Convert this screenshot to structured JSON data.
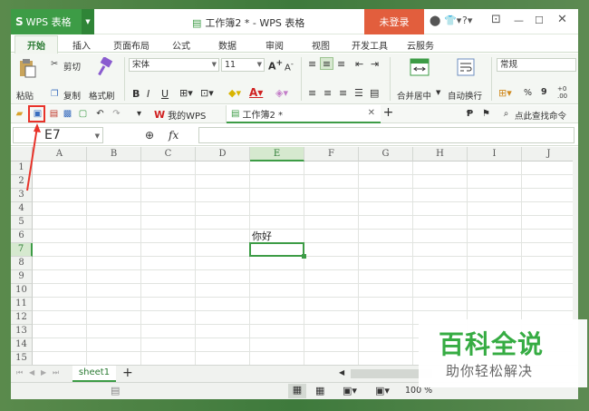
{
  "app": {
    "name": "WPS 表格",
    "logo": "S"
  },
  "document": {
    "title": "工作簿2 * - WPS 表格"
  },
  "titlebar": {
    "login": "未登录"
  },
  "menu": {
    "tabs": [
      "开始",
      "插入",
      "页面布局",
      "公式",
      "数据",
      "审阅",
      "视图",
      "开发工具",
      "云服务"
    ]
  },
  "ribbon": {
    "paste": "粘贴",
    "cut": "剪切",
    "copy": "复制",
    "format_painter": "格式刷",
    "font_name": "宋体",
    "font_size": "11",
    "bold": "B",
    "italic": "I",
    "underline": "U",
    "merge_center": "合并居中",
    "wrap_text": "自动换行",
    "number_format": "常规",
    "percent": "%",
    "thousands": "9"
  },
  "quickbar": {
    "tab_mywps": "我的WPS",
    "tab_workbook": "工作簿2 *",
    "search": "点此查找命令"
  },
  "formula_bar": {
    "cell_ref": "E7",
    "fx": "fx"
  },
  "grid": {
    "columns": [
      "A",
      "B",
      "C",
      "D",
      "E",
      "F",
      "G",
      "H",
      "I",
      "J"
    ],
    "rows": [
      "1",
      "2",
      "3",
      "4",
      "5",
      "6",
      "7",
      "8",
      "9",
      "10",
      "11",
      "12",
      "13",
      "14",
      "15"
    ],
    "cell_E6": "你好",
    "active_cell": "E7"
  },
  "sheets": {
    "active": "sheet1",
    "add": "+"
  },
  "status": {
    "zoom": "100 %"
  },
  "watermark": {
    "title": "百科全说",
    "subtitle": "助你轻松解决"
  },
  "colors": {
    "accent": "#3d9c46",
    "login": "#e25e3d",
    "annotation": "#e8332a"
  }
}
